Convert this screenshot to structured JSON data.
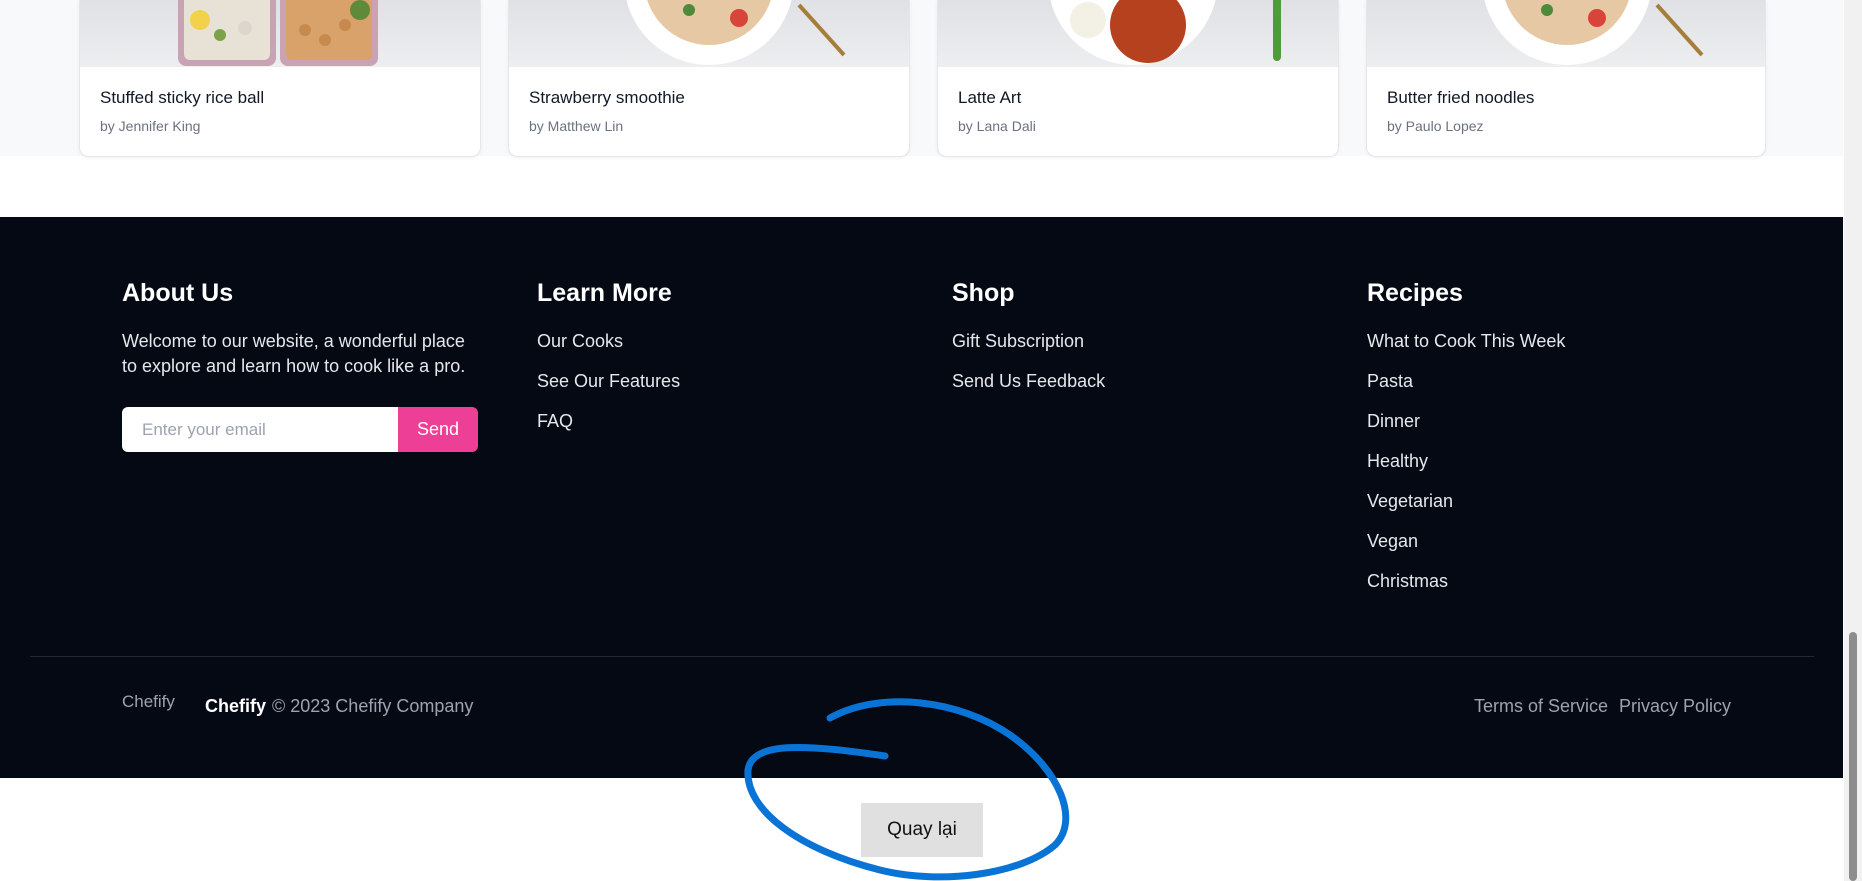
{
  "recipes": [
    {
      "title": "Stuffed sticky rice ball",
      "author": "by Jennifer King"
    },
    {
      "title": "Strawberry smoothie",
      "author": "by Matthew Lin"
    },
    {
      "title": "Latte Art",
      "author": "by Lana Dali"
    },
    {
      "title": "Butter fried noodles",
      "author": "by Paulo Lopez"
    }
  ],
  "footer": {
    "about": {
      "heading": "About Us",
      "text": "Welcome to our website, a wonderful place to explore and learn how to cook like a pro.",
      "email_placeholder": "Enter your email",
      "send_label": "Send"
    },
    "learn_more": {
      "heading": "Learn More",
      "links": [
        "Our Cooks",
        "See Our Features",
        "FAQ"
      ]
    },
    "shop": {
      "heading": "Shop",
      "links": [
        "Gift Subscription",
        "Send Us Feedback"
      ]
    },
    "recipes": {
      "heading": "Recipes",
      "links": [
        "What to Cook This Week",
        "Pasta",
        "Dinner",
        "Healthy",
        "Vegetarian",
        "Vegan",
        "Christmas"
      ]
    },
    "bottom": {
      "logo_alt": "Chefify",
      "brand": "Chefify",
      "copyright": "© 2023 Chefify Company",
      "terms": "Terms of Service",
      "privacy": "Privacy Policy"
    }
  },
  "back_button_label": "Quay lại",
  "colors": {
    "footer_bg": "#050914",
    "accent": "#ec3f95",
    "annotation": "#0a74d6"
  }
}
